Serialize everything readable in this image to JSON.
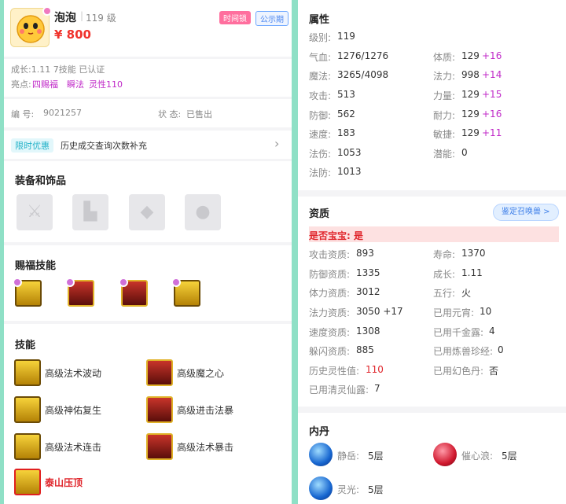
{
  "left": {
    "header": {
      "name": "泡泡",
      "level": "119 级",
      "price": "¥ 800",
      "tag_time_lock": "时间锁",
      "tag_public": "公示期"
    },
    "growth_line": "成长:1.11 7技能 已认证",
    "highlights_label": "亮点:",
    "highlights": [
      "四赐福",
      "瞬法",
      "灵性110"
    ],
    "id_label": "编 号:",
    "id_value": "9021257",
    "status_label": "状 态:",
    "status_value": "已售出",
    "promo_tag": "限时优惠",
    "promo_text": "历史成交查询次数补充",
    "equip_title": "装备和饰品",
    "equip_icons": [
      "sword-icon",
      "boot-icon",
      "armor-icon",
      "ornament-icon"
    ],
    "blessing_title": "赐福技能",
    "skills_title": "技能",
    "skills": [
      {
        "name": "高级法术波动",
        "icon": "wave-icon"
      },
      {
        "name": "高级魔之心",
        "icon": "heart-icon"
      },
      {
        "name": "高级神佑复生",
        "icon": "revive-icon"
      },
      {
        "name": "高级进击法暴",
        "icon": "burst-icon"
      },
      {
        "name": "高级法术连击",
        "icon": "combo-icon"
      },
      {
        "name": "高级法术暴击",
        "icon": "crit-icon"
      },
      {
        "name": "泰山压顶",
        "icon": "mountain-icon"
      }
    ]
  },
  "right": {
    "attr_title": "属性",
    "attrs_left": [
      {
        "label": "级别:",
        "value": "119"
      },
      {
        "label": "气血:",
        "value": "1276/1276"
      },
      {
        "label": "魔法:",
        "value": "3265/4098"
      },
      {
        "label": "攻击:",
        "value": "513"
      },
      {
        "label": "防御:",
        "value": "562"
      },
      {
        "label": "速度:",
        "value": "183"
      },
      {
        "label": "法伤:",
        "value": "1053"
      },
      {
        "label": "法防:",
        "value": "1013"
      }
    ],
    "attrs_right": [
      {
        "label": "体质:",
        "value": "129",
        "bonus": "+16"
      },
      {
        "label": "法力:",
        "value": "998",
        "bonus": "+14"
      },
      {
        "label": "力量:",
        "value": "129",
        "bonus": "+15"
      },
      {
        "label": "耐力:",
        "value": "129",
        "bonus": "+16"
      },
      {
        "label": "敏捷:",
        "value": "129",
        "bonus": "+11"
      },
      {
        "label": "潜能:",
        "value": "0",
        "bonus": ""
      }
    ],
    "apt_title": "资质",
    "apt_button": "鉴定召唤兽 >",
    "baby_line": "是否宝宝: 是",
    "apts_left": [
      {
        "label": "攻击资质:",
        "value": "893"
      },
      {
        "label": "防御资质:",
        "value": "1335"
      },
      {
        "label": "体力资质:",
        "value": "3012"
      },
      {
        "label": "法力资质:",
        "value": "3050 +17"
      },
      {
        "label": "速度资质:",
        "value": "1308"
      },
      {
        "label": "躲闪资质:",
        "value": "885"
      },
      {
        "label": "历史灵性值:",
        "value": "110"
      },
      {
        "label": "已用清灵仙露:",
        "value": "7"
      }
    ],
    "apts_right": [
      {
        "label": "寿命:",
        "value": "1370"
      },
      {
        "label": "成长:",
        "value": "1.11"
      },
      {
        "label": "五行:",
        "value": "火"
      },
      {
        "label": "已用元宵:",
        "value": "10"
      },
      {
        "label": "已用千金露:",
        "value": "4"
      },
      {
        "label": "已用炼兽珍经:",
        "value": "0"
      },
      {
        "label": "已用幻色丹:",
        "value": "否"
      }
    ],
    "neidan_title": "内丹",
    "neidan": [
      {
        "name": "静岳:",
        "level": "5层",
        "icon": "jingyue-icon"
      },
      {
        "name": "催心浪:",
        "level": "5层",
        "icon": "cuixinlang-icon"
      },
      {
        "name": "灵光:",
        "level": "5层",
        "icon": "lingguang-icon"
      }
    ]
  }
}
